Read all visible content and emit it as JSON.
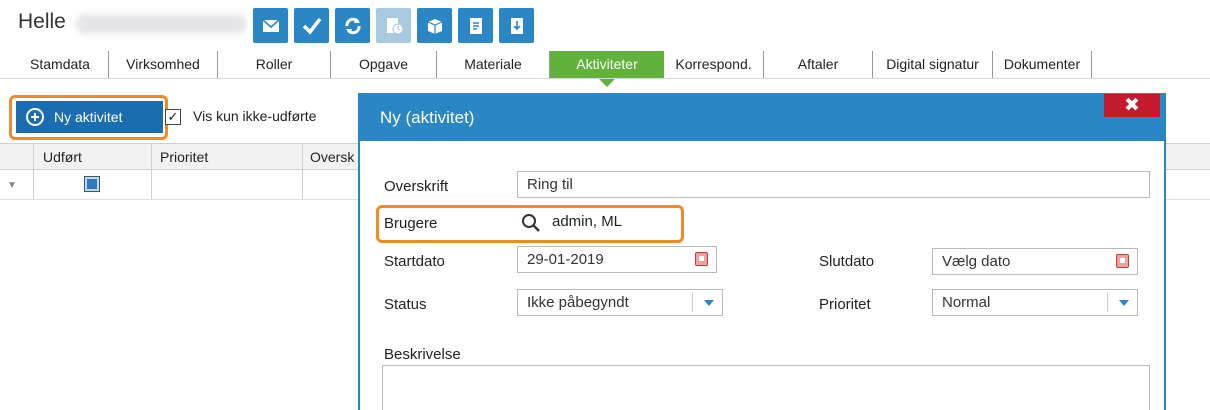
{
  "header": {
    "title": "Helle"
  },
  "toolbar": {
    "buttons": [
      {
        "icon": "envelope-icon"
      },
      {
        "icon": "checkmark-icon"
      },
      {
        "icon": "refresh-icon"
      },
      {
        "icon": "document-clock-icon",
        "disabled": true
      },
      {
        "icon": "box-icon"
      },
      {
        "icon": "document-list-icon"
      },
      {
        "icon": "download-document-icon"
      }
    ]
  },
  "tabs": [
    {
      "label": "Stamdata"
    },
    {
      "label": "Virksomhed"
    },
    {
      "label": "Roller"
    },
    {
      "label": "Opgave"
    },
    {
      "label": "Materiale"
    },
    {
      "label": "Aktiviteter",
      "active": true
    },
    {
      "label": "Korrespond."
    },
    {
      "label": "Aftaler"
    },
    {
      "label": "Digital signatur"
    },
    {
      "label": "Dokumenter"
    }
  ],
  "actions": {
    "new_activity_label": "Ny aktivitet",
    "filter_label": "Vis kun ikke-udførte",
    "filter_checked": true
  },
  "grid": {
    "columns": [
      "Udført",
      "Prioritet",
      "Oversk"
    ]
  },
  "dialog": {
    "title": "Ny (aktivitet)",
    "close_label": "✖",
    "fields": {
      "overskrift_label": "Overskrift",
      "overskrift_value": "Ring til",
      "brugere_label": "Brugere",
      "brugere_value": "admin, ML",
      "startdato_label": "Startdato",
      "startdato_value": "29-01-2019",
      "slutdato_label": "Slutdato",
      "slutdato_value": "Vælg dato",
      "status_label": "Status",
      "status_value": "Ikke påbegyndt",
      "prioritet_label": "Prioritet",
      "prioritet_value": "Normal",
      "beskrivelse_label": "Beskrivelse"
    }
  },
  "colors": {
    "primary_blue": "#2a86c4",
    "dark_blue": "#1a6db0",
    "active_tab_green": "#61b23b",
    "highlight_orange": "#f08a24",
    "close_red": "#c41a2e"
  }
}
